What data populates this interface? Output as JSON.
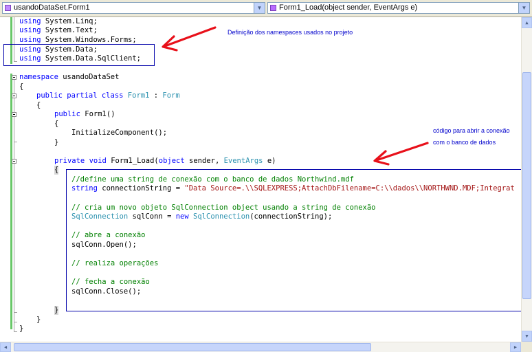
{
  "toolbar": {
    "class_combo": {
      "value": "usandoDataSet.Form1",
      "icon": "class-icon"
    },
    "member_combo": {
      "value": "Form1_Load(object sender, EventArgs e)",
      "icon": "method-icon"
    }
  },
  "code": {
    "l1_kw": "using",
    "l1_rest": " System.Linq;",
    "l2_kw": "using",
    "l2_rest": " System.Text;",
    "l3_kw": "using",
    "l3_rest": " System.Windows.Forms;",
    "l4_kw": "using",
    "l4_rest": " System.Data;",
    "l5_kw": "using",
    "l5_rest": " System.Data.SqlClient;",
    "l7_kw": "namespace",
    "l7_rest": " usandoDataSet",
    "l8": "{",
    "l9_kw1": "public",
    "l9_kw2": "partial",
    "l9_kw3": "class",
    "l9_type1": "Form1",
    "l9_colon": " : ",
    "l9_type2": "Form",
    "l10": "{",
    "l11_kw": "public",
    "l11_rest": " Form1()",
    "l12": "{",
    "l13": "InitializeComponent();",
    "l14": "}",
    "l16_kw1": "private",
    "l16_kw2": "void",
    "l16_name": " Form1_Load(",
    "l16_kw3": "object",
    "l16_sender": " sender, ",
    "l16_type": "EventArgs",
    "l16_end": " e)",
    "l17": "{",
    "l18_comment": "//define uma string de conexão com o banco de dados Northwind.mdf",
    "l19_kw": "string",
    "l19_mid": " connectionString = ",
    "l19_str": "\"Data Source=.\\\\SQLEXPRESS;AttachDbFilename=C:\\\\dados\\\\NORTHWND.MDF;Integrat",
    "l21_comment": "// cria um novo objeto SqlConnection object usando a string de conexão",
    "l22_type1": "SqlConnection",
    "l22_mid": " sqlConn = ",
    "l22_kw": "new",
    "l22_type2": "SqlConnection",
    "l22_end": "(connectionString);",
    "l24_comment": "// abre a conexão",
    "l25": "sqlConn.Open();",
    "l27_comment": "// realiza operações",
    "l29_comment": "// fecha a conexão",
    "l30": "sqlConn.Close();",
    "l32": "}",
    "l33": "}",
    "l34": "}"
  },
  "annotations": {
    "namespaces_note": "Definição dos namespaces usados no projeto",
    "connection_note_line1": "código para abrir a conexão",
    "connection_note_line2": "com o banco de dados",
    "arrow_color": "#e8101a",
    "box_color": "#0000aa"
  },
  "colors": {
    "keyword": "#0000ff",
    "type": "#2b91af",
    "comment": "#008000",
    "string": "#a31515"
  }
}
